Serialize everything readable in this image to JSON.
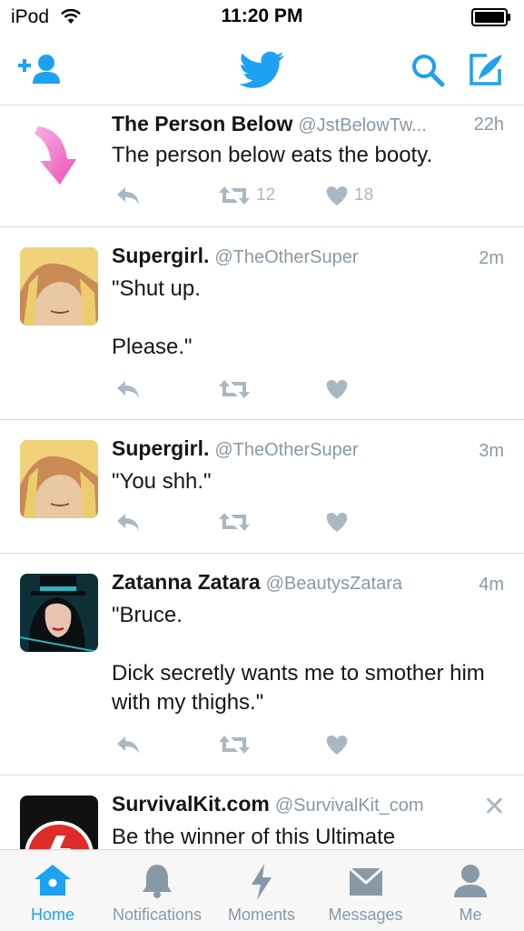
{
  "status_bar": {
    "carrier": "iPod",
    "time": "11:20 PM"
  },
  "colors": {
    "brand": "#1da1f2",
    "muted": "#8899a6",
    "icon_gray": "#aab8c2",
    "pink_arrow": "#f062c7"
  },
  "nav": {
    "left_icon": "add-user-icon",
    "center_icon": "twitter-bird-icon",
    "right_icons": [
      "search-icon",
      "compose-icon"
    ]
  },
  "tweets": [
    {
      "name": "The Person Below",
      "handle": "@JstBelowTw...",
      "time": "22h",
      "text": "The person below eats the booty.",
      "retweets": "12",
      "likes": "18",
      "avatar": "pink-arrow"
    },
    {
      "name": "Supergirl.",
      "handle": "@TheOtherSuper",
      "time": "2m",
      "text": "\"Shut up.\n\nPlease.\"",
      "retweets": "",
      "likes": "",
      "avatar": "supergirl"
    },
    {
      "name": "Supergirl.",
      "handle": "@TheOtherSuper",
      "time": "3m",
      "text": "\"You shh.\"",
      "retweets": "",
      "likes": "",
      "avatar": "supergirl"
    },
    {
      "name": "Zatanna Zatara",
      "handle": "@BeautysZatara",
      "time": "4m",
      "text": "\"Bruce.\n\nDick secretly wants me to smother him with my thighs.\"",
      "retweets": "",
      "likes": "",
      "avatar": "zatanna"
    },
    {
      "name": "SurvivalKit.com",
      "handle": "@SurvivalKit_com",
      "time": "",
      "text": "Be the winner of this Ultimate",
      "retweets": "",
      "likes": "",
      "avatar": "survivalkit",
      "dismiss": "✕"
    }
  ],
  "tabs": [
    {
      "label": "Home",
      "icon": "home-icon",
      "active": true
    },
    {
      "label": "Notifications",
      "icon": "bell-icon",
      "active": false
    },
    {
      "label": "Moments",
      "icon": "lightning-icon",
      "active": false
    },
    {
      "label": "Messages",
      "icon": "envelope-icon",
      "active": false
    },
    {
      "label": "Me",
      "icon": "person-icon",
      "active": false
    }
  ]
}
